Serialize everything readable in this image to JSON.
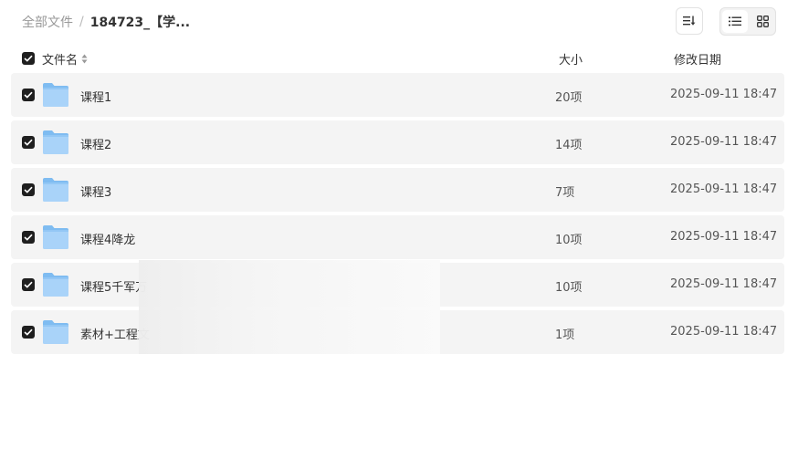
{
  "breadcrumb": {
    "root": "全部文件",
    "separator": "/",
    "current": "184723_【学..."
  },
  "toolbar": {
    "sort_icon": "sort-icon",
    "list_view_icon": "list-view-icon",
    "grid_view_icon": "grid-view-icon",
    "active_view": "list"
  },
  "table": {
    "headers": {
      "name": "文件名",
      "size": "大小",
      "date": "修改日期"
    },
    "rows": [
      {
        "name": "课程1",
        "size": "20项",
        "date": "2025-09-11 18:47",
        "checked": true,
        "icon": "folder-icon"
      },
      {
        "name": "课程2",
        "size": "14项",
        "date": "2025-09-11 18:47",
        "checked": true,
        "icon": "folder-icon"
      },
      {
        "name": "课程3",
        "size": "7项",
        "date": "2025-09-11 18:47",
        "checked": true,
        "icon": "folder-icon"
      },
      {
        "name": "课程4降龙",
        "size": "10项",
        "date": "2025-09-11 18:47",
        "checked": true,
        "icon": "folder-icon"
      },
      {
        "name": "课程5千军万",
        "size": "10项",
        "date": "2025-09-11 18:47",
        "checked": true,
        "icon": "folder-icon"
      },
      {
        "name": "素材+工程文",
        "size": "1项",
        "date": "2025-09-11 18:47",
        "checked": true,
        "icon": "folder-icon"
      }
    ]
  },
  "colors": {
    "row_background": "#f4f4f4",
    "checkbox": "#1f1f1f",
    "folder_light": "#a9d3f9",
    "folder_dark": "#7fbcf1"
  }
}
